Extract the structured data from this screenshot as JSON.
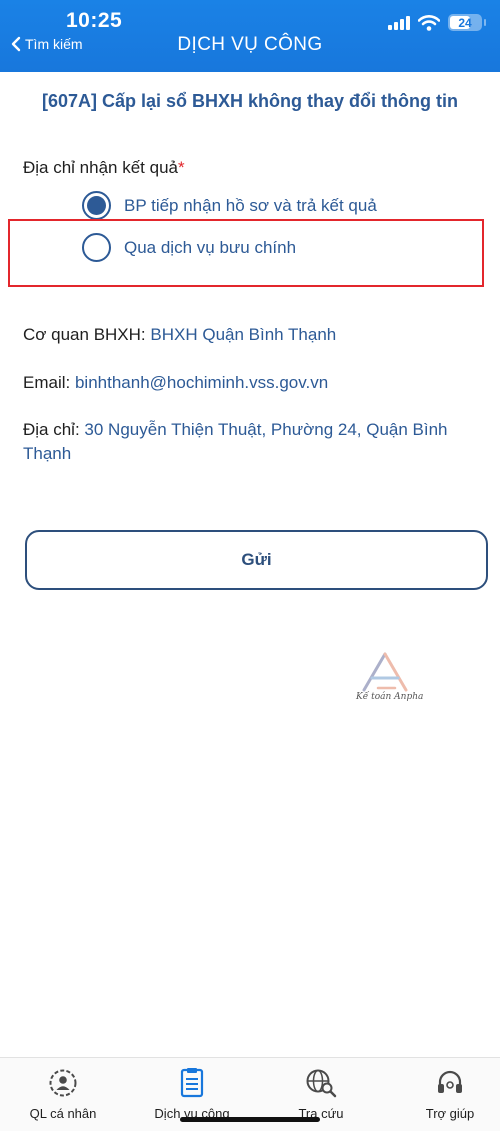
{
  "status_bar": {
    "time": "10:25",
    "battery": "24"
  },
  "header": {
    "back_label": "Tìm kiếm",
    "title": "DỊCH VỤ CÔNG"
  },
  "form": {
    "procedure_title": "[607A] Cấp lại sổ BHXH không thay đổi thông tin",
    "result_address_label": "Địa chỉ nhận kết quả",
    "required_mark": "*",
    "options": [
      {
        "label": "BP tiếp nhận hồ sơ và trả kết quả",
        "selected": true
      },
      {
        "label": "Qua dịch vụ bưu chính",
        "selected": false
      }
    ],
    "agency_label": "Cơ quan BHXH:",
    "agency_value": "BHXH Quận Bình Thạnh",
    "email_label": "Email:",
    "email_value": "binhthanh@hochiminh.vss.gov.vn",
    "address_label": "Địa chỉ:",
    "address_value": "30 Nguyễn Thiện Thuật, Phường 24, Quận Bình Thạnh",
    "submit_label": "Gửi"
  },
  "watermark": {
    "text": "Kế toán Anpha"
  },
  "tab_bar": {
    "items": [
      {
        "label": "QL cá nhân",
        "icon": "person-gear-icon"
      },
      {
        "label": "Dịch vụ công",
        "icon": "document-icon",
        "active": true
      },
      {
        "label": "Tra cứu",
        "icon": "globe-search-icon"
      },
      {
        "label": "Trợ giúp",
        "icon": "headset-icon"
      }
    ]
  },
  "colors": {
    "header": "#1877dc",
    "accent": "#2d5a96",
    "highlight": "#e3262c"
  }
}
